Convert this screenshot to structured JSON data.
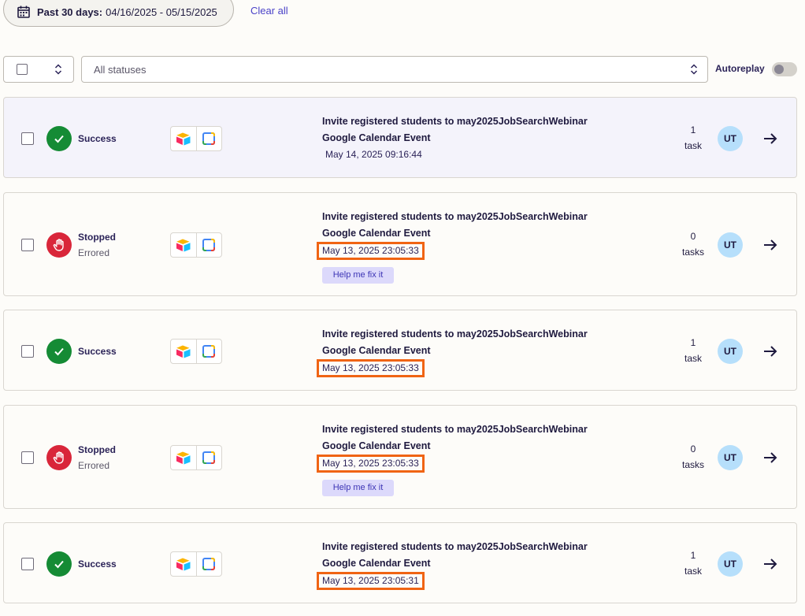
{
  "filters": {
    "date_range_label": "Past 30 days:",
    "date_range_value": "04/16/2025 - 05/15/2025",
    "clear_all": "Clear all",
    "status_filter": "All statuses",
    "autoreplay_label": "Autoreplay"
  },
  "runs": [
    {
      "status": "Success",
      "status_kind": "success",
      "substatus": "",
      "zap_name": "Invite registered students to may2025JobSearchWebinar",
      "step_name": "Google Calendar Event",
      "timestamp": "May 14, 2025 09:16:44",
      "task_count": "1",
      "task_unit": "task",
      "avatar": "UT",
      "help_label": ""
    },
    {
      "status": "Stopped",
      "status_kind": "stopped",
      "substatus": "Errored",
      "zap_name": "Invite registered students to may2025JobSearchWebinar",
      "step_name": "Google Calendar Event",
      "timestamp": "May 13, 2025 23:05:33",
      "task_count": "0",
      "task_unit": "tasks",
      "avatar": "UT",
      "help_label": "Help me fix it"
    },
    {
      "status": "Success",
      "status_kind": "success",
      "substatus": "",
      "zap_name": "Invite registered students to may2025JobSearchWebinar",
      "step_name": "Google Calendar Event",
      "timestamp": "May 13, 2025 23:05:33",
      "task_count": "1",
      "task_unit": "task",
      "avatar": "UT",
      "help_label": ""
    },
    {
      "status": "Stopped",
      "status_kind": "stopped",
      "substatus": "Errored",
      "zap_name": "Invite registered students to may2025JobSearchWebinar",
      "step_name": "Google Calendar Event",
      "timestamp": "May 13, 2025 23:05:33",
      "task_count": "0",
      "task_unit": "tasks",
      "avatar": "UT",
      "help_label": "Help me fix it"
    },
    {
      "status": "Success",
      "status_kind": "success",
      "substatus": "",
      "zap_name": "Invite registered students to may2025JobSearchWebinar",
      "step_name": "Google Calendar Event",
      "timestamp": "May 13, 2025 23:05:31",
      "task_count": "1",
      "task_unit": "task",
      "avatar": "UT",
      "help_label": ""
    }
  ],
  "icons": {
    "calendar": "calendar-icon",
    "success": "check-icon",
    "stopped": "hand-stop-icon",
    "app1": "airtable-icon",
    "app2": "google-calendar-icon",
    "open": "arrow-right-icon"
  },
  "colors": {
    "success": "#158b35",
    "stopped": "#d9263a",
    "link": "#4a42c8",
    "highlight_box": "#f06414",
    "avatar_bg": "#b6dffb"
  }
}
